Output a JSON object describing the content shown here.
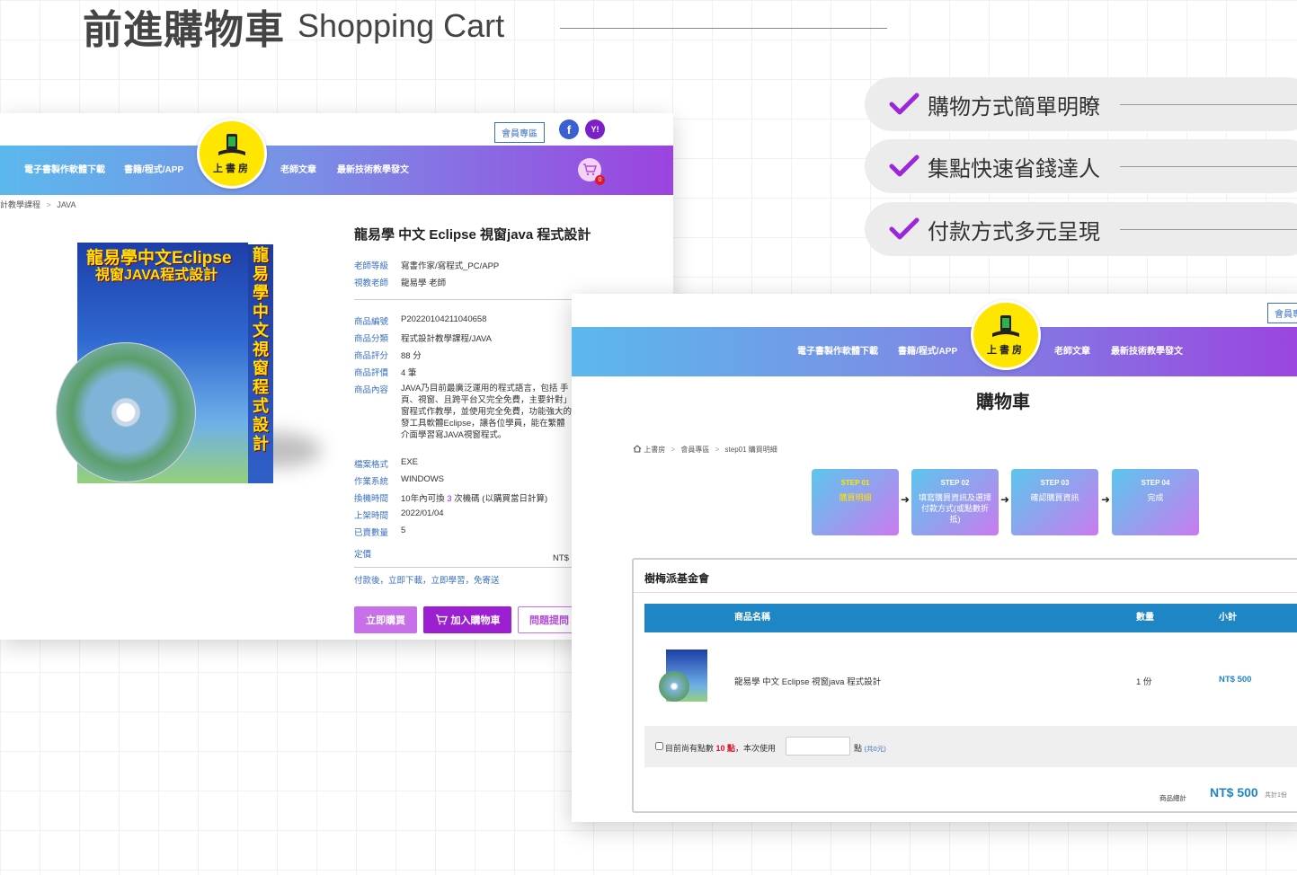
{
  "heading": {
    "zh": "前進購物車",
    "en": "Shopping Cart"
  },
  "features": [
    {
      "label": "購物方式簡單明瞭",
      "icon": "check-icon"
    },
    {
      "label": "集點快速省錢達人",
      "icon": "check-icon"
    },
    {
      "label": "付款方式多元呈現",
      "icon": "check-icon"
    }
  ],
  "colors": {
    "accent_purple": "#9c27d9",
    "nav_start": "#5bb8ec",
    "nav_end": "#9b43df",
    "table_header": "#1f86c6",
    "price_blue": "#1f86c6"
  },
  "product_page": {
    "member_button": "會員專區",
    "social": {
      "facebook": "f",
      "yahoo": "Y!"
    },
    "nav": {
      "left1": "電子書製作軟體下載",
      "left2": "書籍/程式/APP",
      "right1": "老師文章",
      "right2": "最新技術教學發文"
    },
    "logo_text": "上書房",
    "cart_count": "0",
    "breadcrumb": {
      "part1": "計教學課程",
      "sep": ">",
      "part2": "JAVA"
    },
    "book": {
      "title_line1": "龍易學中文Eclipse",
      "title_line2": "視窗JAVA程式設計",
      "spine": "龍易學中文視窗程式設計"
    },
    "title": "龍易學 中文 Eclipse 視窗java 程式設計",
    "teacher_level": {
      "label": "老師等級",
      "value": "寫書作家/寫程式_PC/APP"
    },
    "teacher": {
      "label": "視教老師",
      "value": "龍易學 老師"
    },
    "product_no": {
      "label": "商品編號",
      "value": "P20220104211040658"
    },
    "category": {
      "label": "商品分類",
      "value": "程式設計教學課程/JAVA"
    },
    "rating": {
      "label": "商品評分",
      "value": "88 分"
    },
    "reviews": {
      "label": "商品評價",
      "value": "4 筆"
    },
    "content": {
      "label": "商品內容",
      "lines": [
        "JAVA乃目前最廣泛運用的程式語言，包括 手",
        "頁、視窗、且跨平台又完全免費，主要針對」",
        "窗程式作教學，並使用完全免費，功能強大的",
        "發工具軟體Eclipse，讓各位學員，能在繁體",
        "介面學習寫JAVA視窗程式。"
      ]
    },
    "file_format": {
      "label": "檔案格式",
      "value": "EXE"
    },
    "os": {
      "label": "作業系統",
      "value": "WINDOWS"
    },
    "machine_change": {
      "label": "換機時間",
      "value_pre": "10年內可換 ",
      "value_num": "3",
      "value_post": " 次機碼 (以購買當日計算)"
    },
    "release": {
      "label": "上架時間",
      "value": "2022/01/04"
    },
    "sold": {
      "label": "已賣數量",
      "value": "5"
    },
    "price": {
      "label": "定價",
      "value": "NT$"
    },
    "note": "付款後，立即下載，立即學習，免寄送",
    "buttons": {
      "buy_now": "立即購買",
      "add_cart": "加入購物車",
      "ask": "問題提問"
    }
  },
  "cart_page": {
    "member_button": "會員專",
    "nav": {
      "left1": "電子書製作軟體下載",
      "left2": "書籍/程式/APP",
      "right1": "老師文章",
      "right2": "最新技術教學發文"
    },
    "logo_text": "上書房",
    "title": "購物車",
    "breadcrumb": {
      "home": "上書房",
      "sep": ">",
      "member": "會員專區",
      "step": "step01 購買明細"
    },
    "steps": [
      {
        "no": "STEP 01",
        "desc": "購買明細"
      },
      {
        "no": "STEP 02",
        "desc": "填寫購買資訊及選擇付款方式(或點數折抵)"
      },
      {
        "no": "STEP 03",
        "desc": "確認購買資訊"
      },
      {
        "no": "STEP 04",
        "desc": "完成"
      }
    ],
    "seller": "樹梅派基金會",
    "table_headers": {
      "name": "商品名稱",
      "qty": "數量",
      "subtotal": "小計"
    },
    "item": {
      "name": "龍易學 中文 Eclipse 視窗java 程式設計",
      "qty": "1 份",
      "subtotal": "NT$ 500"
    },
    "points": {
      "pre": "目前尚有點數 ",
      "amount": "10 點",
      "mid": "，本次使用",
      "unit": "點",
      "note": "(共0元)"
    },
    "total": {
      "label": "商品總計",
      "value": "NT$ 500",
      "count": "共計1份"
    }
  }
}
